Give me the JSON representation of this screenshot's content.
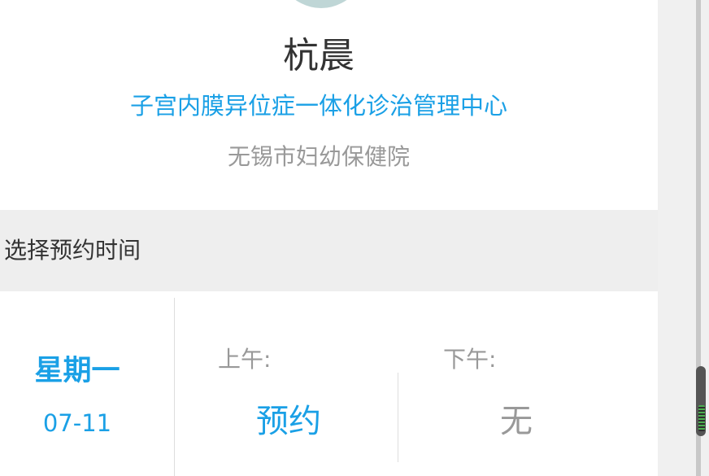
{
  "doctor": {
    "name": "杭晨",
    "department": "子宫内膜异位症一体化诊治管理中心",
    "hospital": "无锡市妇幼保健院"
  },
  "schedule_section": {
    "title": "选择预约时间"
  },
  "schedule": {
    "weekday": "星期一",
    "date": "07-11",
    "am_label": "上午:",
    "am_status": "预约",
    "pm_label": "下午:",
    "pm_status": "无"
  },
  "colors": {
    "accent": "#1aa0e6",
    "muted": "#999999",
    "section_bg": "#eeeeee"
  }
}
